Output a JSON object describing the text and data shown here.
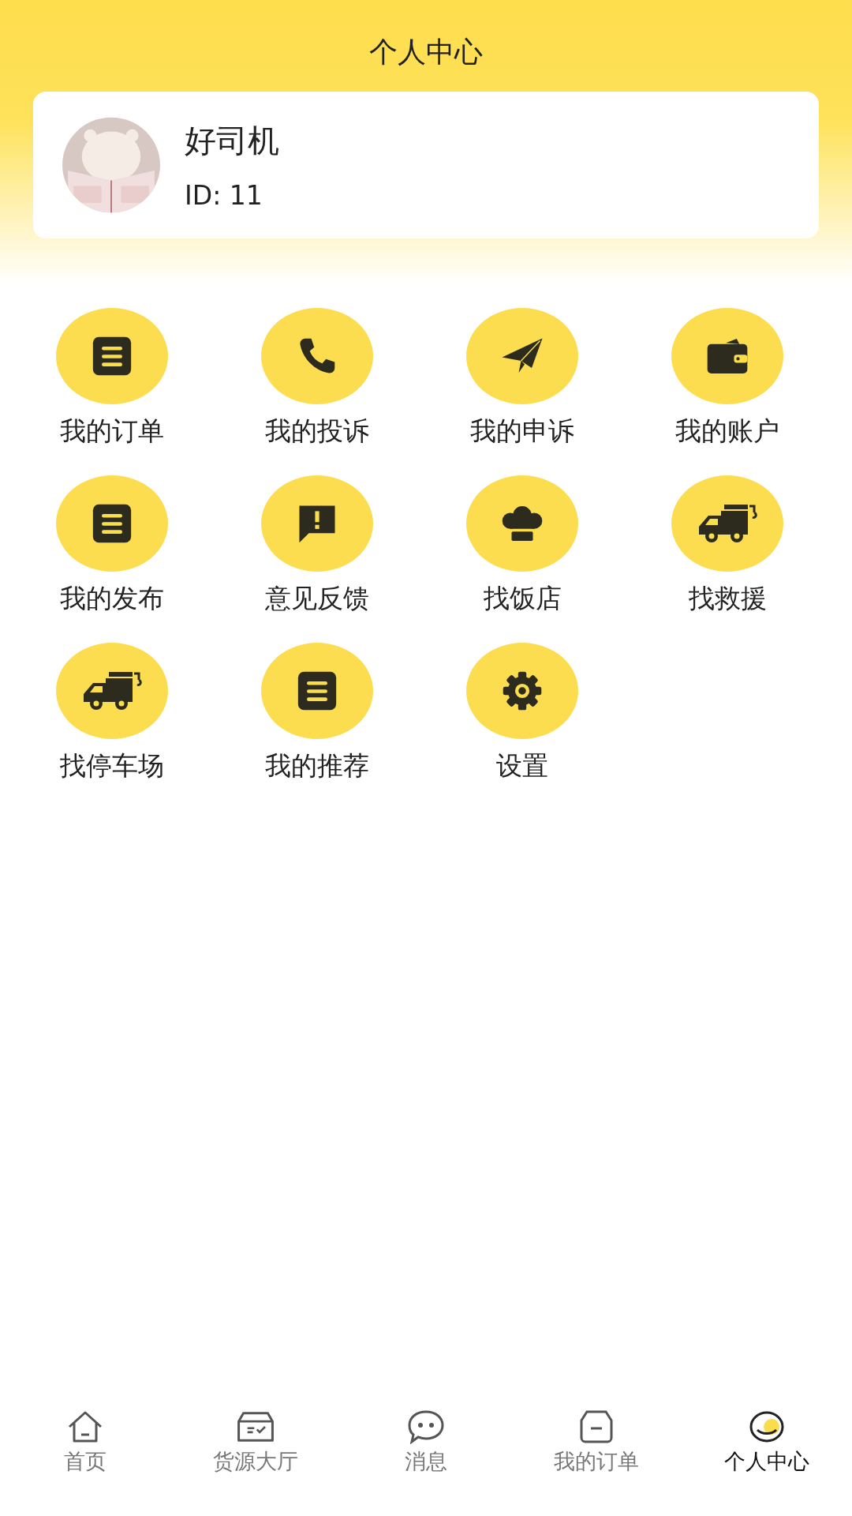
{
  "header": {
    "title": "个人中心"
  },
  "profile": {
    "name": "好司机",
    "id_text": "ID: 11"
  },
  "menu": [
    {
      "label": "我的订单"
    },
    {
      "label": "我的投诉"
    },
    {
      "label": "我的申诉"
    },
    {
      "label": "我的账户"
    },
    {
      "label": "我的发布"
    },
    {
      "label": "意见反馈"
    },
    {
      "label": "找饭店"
    },
    {
      "label": "找救援"
    },
    {
      "label": "找停车场"
    },
    {
      "label": "我的推荐"
    },
    {
      "label": "设置"
    }
  ],
  "tab_bar": [
    {
      "label": "首页",
      "selected": false
    },
    {
      "label": "货源大厅",
      "selected": false
    },
    {
      "label": "消息",
      "selected": false
    },
    {
      "label": "我的订单",
      "selected": false
    },
    {
      "label": "个人中心",
      "selected": true
    }
  ]
}
